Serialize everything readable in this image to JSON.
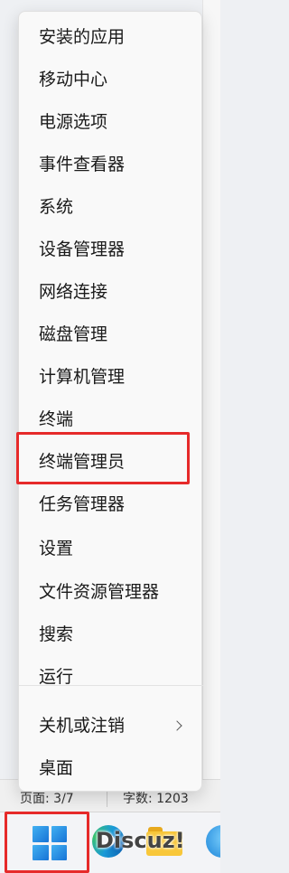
{
  "context_menu": {
    "items": [
      {
        "label": "安装的应用"
      },
      {
        "label": "移动中心"
      },
      {
        "label": "电源选项"
      },
      {
        "label": "事件查看器"
      },
      {
        "label": "系统"
      },
      {
        "label": "设备管理器"
      },
      {
        "label": "网络连接"
      },
      {
        "label": "磁盘管理"
      },
      {
        "label": "计算机管理"
      },
      {
        "label": "终端"
      },
      {
        "label": "终端管理员"
      },
      {
        "label": "任务管理器"
      },
      {
        "label": "设置"
      },
      {
        "label": "文件资源管理器"
      },
      {
        "label": "搜索"
      },
      {
        "label": "运行"
      },
      {
        "label": "关机或注销",
        "submenu_icon": "chevron-right-icon"
      },
      {
        "label": "桌面"
      }
    ],
    "highlighted_item": "终端管理员"
  },
  "status_bar": {
    "page": "页面: 3/7",
    "words": "字数: 1203"
  },
  "taskbar": {
    "icons": [
      "windows-start-icon",
      "edge-icon",
      "file-explorer-icon",
      "edge-icon"
    ],
    "watermark": "Discuz!"
  },
  "colors": {
    "highlight": "#e62a2a",
    "menu_background": "#f9f9f9"
  }
}
